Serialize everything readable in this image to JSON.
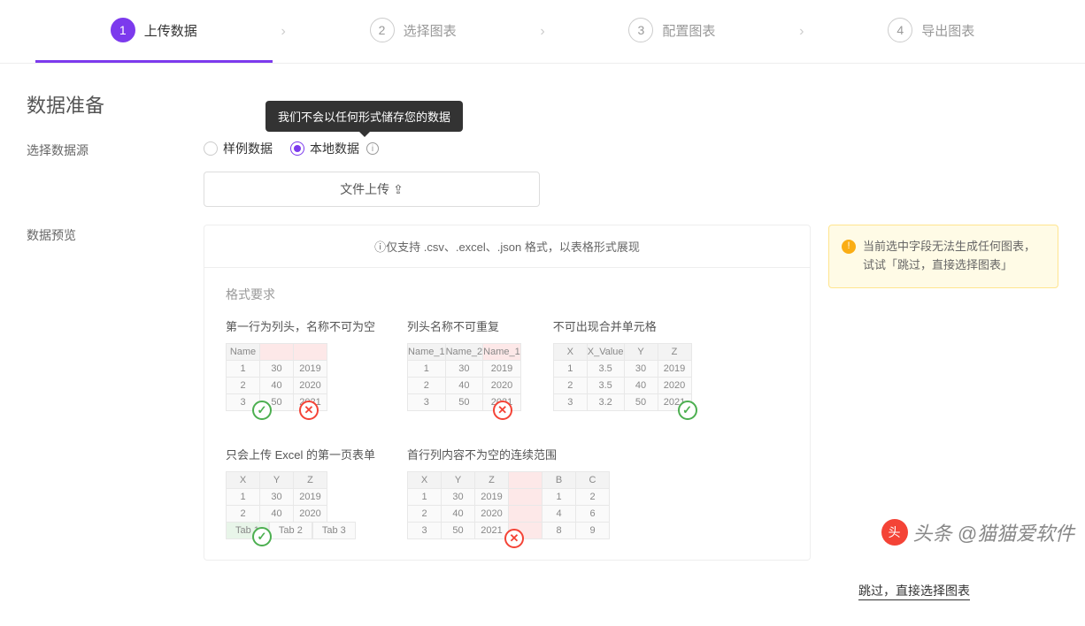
{
  "steps": [
    {
      "num": "1",
      "label": "上传数据"
    },
    {
      "num": "2",
      "label": "选择图表"
    },
    {
      "num": "3",
      "label": "配置图表"
    },
    {
      "num": "4",
      "label": "导出图表"
    }
  ],
  "page_title": "数据准备",
  "source": {
    "label": "选择数据源",
    "sample": "样例数据",
    "local": "本地数据",
    "tooltip": "我们不会以任何形式储存您的数据"
  },
  "upload_btn": "文件上传 ⇪",
  "preview": {
    "label": "数据预览",
    "hint": "ⓘ仅支持 .csv、.excel、.json 格式，以表格形式展现",
    "format_title": "格式要求",
    "ex1_title": "第一行为列头，名称不可为空",
    "ex2_title": "列头名称不可重复",
    "ex3_title": "不可出现合并单元格",
    "ex4_title": "只会上传 Excel 的第一页表单",
    "ex5_title": "首行列内容不为空的连续范围",
    "t1_h": "Name",
    "t1_r": [
      [
        "1",
        "30",
        "2019"
      ],
      [
        "2",
        "40",
        "2020"
      ],
      [
        "3",
        "50",
        "2021"
      ]
    ],
    "t2_h": [
      "Name_1",
      "Name_2",
      "Name_1"
    ],
    "t2_r": [
      [
        "1",
        "30",
        "2019"
      ],
      [
        "2",
        "40",
        "2020"
      ],
      [
        "3",
        "50",
        "2021"
      ]
    ],
    "t3_h": [
      "X",
      "X_Value",
      "Y",
      "Z"
    ],
    "t3_r": [
      [
        "1",
        "3.5",
        "30",
        "2019"
      ],
      [
        "2",
        "3.5",
        "40",
        "2020"
      ],
      [
        "3",
        "3.2",
        "50",
        "2021"
      ]
    ],
    "t4_h": [
      "X",
      "Y",
      "Z"
    ],
    "t4_r": [
      [
        "1",
        "30",
        "2019"
      ],
      [
        "2",
        "40",
        "2020"
      ]
    ],
    "t4_tabs": [
      "Tab 1",
      "Tab 2",
      "Tab 3"
    ],
    "t5_h": [
      "X",
      "Y",
      "Z",
      "",
      "B",
      "C"
    ],
    "t5_r": [
      [
        "1",
        "30",
        "2019",
        "",
        "1",
        "2"
      ],
      [
        "2",
        "40",
        "2020",
        "",
        "4",
        "6"
      ],
      [
        "3",
        "50",
        "2021",
        "",
        "8",
        "9"
      ]
    ]
  },
  "warning": "当前选中字段无法生成任何图表，试试「跳过，直接选择图表」",
  "skip_link": "跳过，直接选择图表",
  "watermark": "头条 @猫猫爱软件"
}
